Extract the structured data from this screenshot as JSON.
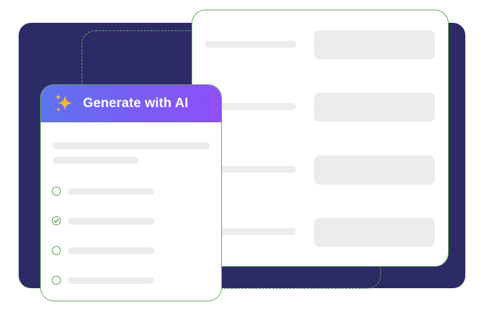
{
  "ai_panel": {
    "title": "Generate with AI",
    "header_icon": "sparkle-icon",
    "options": [
      {
        "state": "unchecked"
      },
      {
        "state": "checked"
      },
      {
        "state": "unchecked"
      },
      {
        "state": "unchecked"
      }
    ]
  },
  "form": {
    "rows": 4
  },
  "colors": {
    "navy_background": "#2d2b66",
    "card_border": "#5aa84f",
    "gradient_start": "#5d74f0",
    "gradient_end": "#8f4ff7",
    "sparkle": "#f6b930",
    "placeholder": "#ececec"
  }
}
